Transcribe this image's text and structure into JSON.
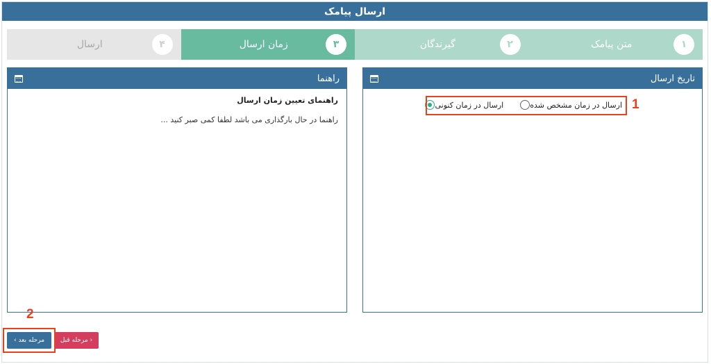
{
  "header": {
    "title": "ارسال پیامک"
  },
  "wizard": {
    "steps": [
      {
        "number": "۱",
        "label": "متن پیامک",
        "state": "done"
      },
      {
        "number": "۲",
        "label": "گیرندگان",
        "state": "done"
      },
      {
        "number": "۳",
        "label": "زمان ارسال",
        "state": "active"
      },
      {
        "number": "۴",
        "label": "ارسال",
        "state": "pending"
      }
    ]
  },
  "send_panel": {
    "title": "تاریخ ارسال",
    "icon": "calendar-icon",
    "options": [
      {
        "label": "ارسال در زمان کنونی",
        "checked": true
      },
      {
        "label": "ارسال در زمان مشخص شده",
        "checked": false
      }
    ]
  },
  "guide_panel": {
    "title": "راهنما",
    "icon": "calendar-icon",
    "heading": "راهنمای تعیین زمان ارسال",
    "text": "راهنما در حال بارگذاری می باشد لطفا کمی صبر کنید ..."
  },
  "buttons": {
    "next": "مرحله بعد ›",
    "prev": "‹ مرحله قبل"
  },
  "annotations": {
    "one": "1",
    "two": "2"
  },
  "colors": {
    "primary": "#386f9b",
    "step_done": "#aed8ca",
    "step_active": "#68bb9f",
    "step_pending": "#e6e6e6",
    "danger": "#d33e5e",
    "highlight": "#e8411c"
  }
}
